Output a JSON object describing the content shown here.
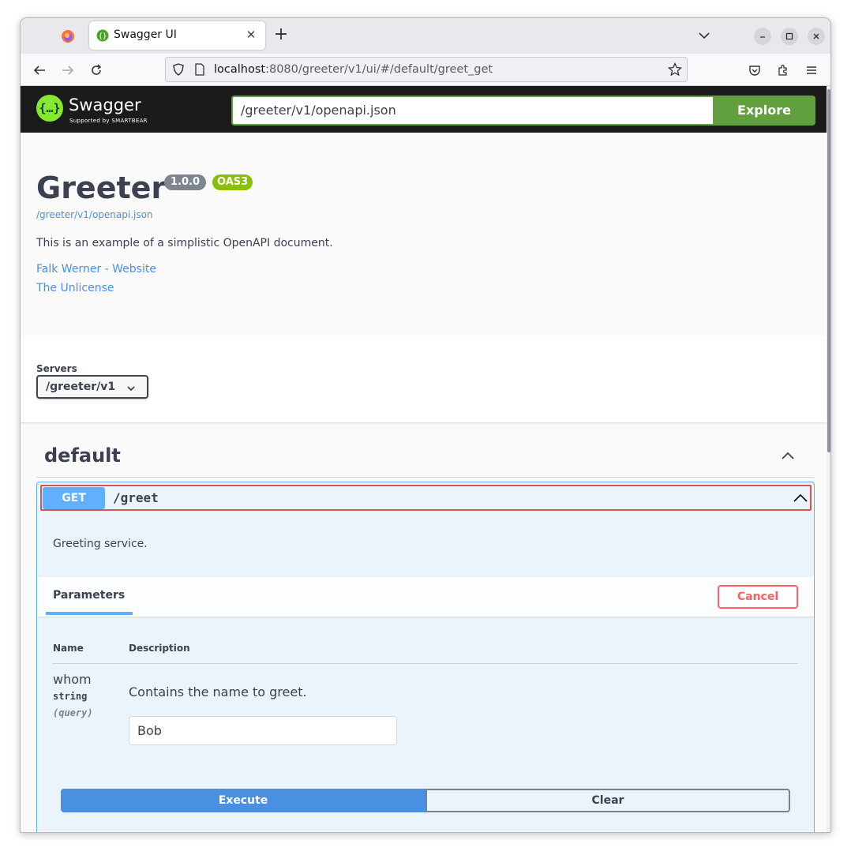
{
  "browser": {
    "tab_title": "Swagger UI",
    "tab_close_glyph": "✕",
    "new_tab_glyph": "+",
    "url_host": "localhost",
    "url_rest": ":8080/greeter/v1/ui/#/default/greet_get"
  },
  "topbar": {
    "logo_mark": "{…}",
    "logo_text": "Swagger",
    "logo_sub": "Supported by SMARTBEAR",
    "spec_url": "/greeter/v1/openapi.json",
    "explore_label": "Explore"
  },
  "info": {
    "title": "Greeter",
    "version": "1.0.0",
    "oas_badge": "OAS3",
    "spec_link": "/greeter/v1/openapi.json",
    "description": "This is an example of a simplistic OpenAPI document.",
    "contact": "Falk Werner - Website",
    "license": "The Unlicense"
  },
  "servers": {
    "label": "Servers",
    "selected": "/greeter/v1"
  },
  "tag": {
    "name": "default"
  },
  "operation": {
    "method": "GET",
    "path": "/greet",
    "description": "Greeting service.",
    "params_tab": "Parameters",
    "cancel_label": "Cancel",
    "col_name": "Name",
    "col_description": "Description",
    "param": {
      "name": "whom",
      "type": "string",
      "in": "(query)",
      "description": "Contains the name to greet.",
      "value": "Bob"
    },
    "execute_label": "Execute",
    "clear_label": "Clear"
  },
  "colors": {
    "swagger_green": "#85ea2d",
    "explore_green": "#62a03f",
    "get_blue": "#61affe",
    "execute_blue": "#4990e2",
    "cancel_red": "#ff6060"
  }
}
